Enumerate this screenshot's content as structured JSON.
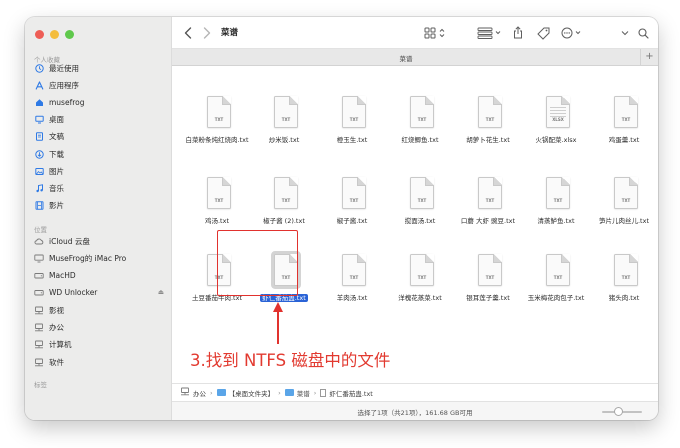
{
  "window": {
    "title": "菜谱",
    "tab_label": "菜谱"
  },
  "colors": {
    "close": "#ee5e56",
    "minimize": "#f4bd3d",
    "zoom": "#5fc84b",
    "accent": "#2a63d6",
    "annotation": "#e23a30",
    "sidebar_icon": "#2f7ae5"
  },
  "sidebar": {
    "favorites_header": "个人收藏",
    "favorites": [
      {
        "label": "最近使用",
        "icon": "clock-icon"
      },
      {
        "label": "应用程序",
        "icon": "apps-icon"
      },
      {
        "label": "musefrog",
        "icon": "home-icon"
      },
      {
        "label": "桌面",
        "icon": "desktop-icon"
      },
      {
        "label": "文稿",
        "icon": "document-icon"
      },
      {
        "label": "下载",
        "icon": "download-icon"
      },
      {
        "label": "图片",
        "icon": "photo-icon"
      },
      {
        "label": "音乐",
        "icon": "music-icon"
      },
      {
        "label": "影片",
        "icon": "film-icon"
      }
    ],
    "locations_header": "位置",
    "locations": [
      {
        "label": "iCloud 云盘",
        "icon": "cloud-icon",
        "eject": false
      },
      {
        "label": "MuseFrog的 iMac Pro",
        "icon": "computer-icon",
        "eject": false
      },
      {
        "label": "MacHD",
        "icon": "disk-icon",
        "eject": false
      },
      {
        "label": "WD Unlocker",
        "icon": "disk-icon",
        "eject": true
      },
      {
        "label": "影视",
        "icon": "network-icon",
        "eject": false
      },
      {
        "label": "办公",
        "icon": "network-icon",
        "eject": false
      },
      {
        "label": "计算机",
        "icon": "network-icon",
        "eject": false
      },
      {
        "label": "软件",
        "icon": "network-icon",
        "eject": false
      }
    ],
    "tags_header": "标签"
  },
  "files": [
    {
      "name": "白菜粉条炖红烧肉.txt",
      "tag": "TXT"
    },
    {
      "name": "炒米饭.txt",
      "tag": "TXT"
    },
    {
      "name": "橙玉生.txt",
      "tag": "TXT"
    },
    {
      "name": "红烧鲫鱼.txt",
      "tag": "TXT"
    },
    {
      "name": "胡萝卜花生.txt",
      "tag": "TXT"
    },
    {
      "name": "火锅配菜.xlsx",
      "tag": "XLSX"
    },
    {
      "name": "鸡蛋羹.txt",
      "tag": "TXT"
    },
    {
      "name": "鸡汤.txt",
      "tag": "TXT"
    },
    {
      "name": "椒子酱 (2).txt",
      "tag": "TXT"
    },
    {
      "name": "椒子酱.txt",
      "tag": "TXT"
    },
    {
      "name": "搅面汤.txt",
      "tag": "TXT"
    },
    {
      "name": "口蘑 大虾 豌豆.txt",
      "tag": "TXT"
    },
    {
      "name": "清蒸鲈鱼.txt",
      "tag": "TXT"
    },
    {
      "name": "笋片儿肉丝儿.txt",
      "tag": "TXT"
    },
    {
      "name": "土豆番茄牛肉.txt",
      "tag": "TXT"
    },
    {
      "name": "虾仁番茄蛊.txt",
      "tag": "TXT",
      "selected": true
    },
    {
      "name": "羊肉汤.txt",
      "tag": "TXT"
    },
    {
      "name": "洋槐花蒸菜.txt",
      "tag": "TXT"
    },
    {
      "name": "银耳莲子羹.txt",
      "tag": "TXT"
    },
    {
      "name": "玉米梅花肉包子.txt",
      "tag": "TXT"
    },
    {
      "name": "猪头肉.txt",
      "tag": "TXT"
    }
  ],
  "annotation": {
    "caption": "3.找到 NTFS 磁盘中的文件"
  },
  "pathbar": {
    "segments": [
      {
        "label": "办公",
        "icon": "network-icon"
      },
      {
        "label": "【桌面文件夹】",
        "icon": "folder-icon"
      },
      {
        "label": "菜谱",
        "icon": "folder-icon"
      },
      {
        "label": "虾仁番茄蛊.txt",
        "icon": "file-icon"
      }
    ]
  },
  "status": {
    "text": "选择了1项（共21项），161.68 GB可用",
    "zoom_level": 0.4
  }
}
